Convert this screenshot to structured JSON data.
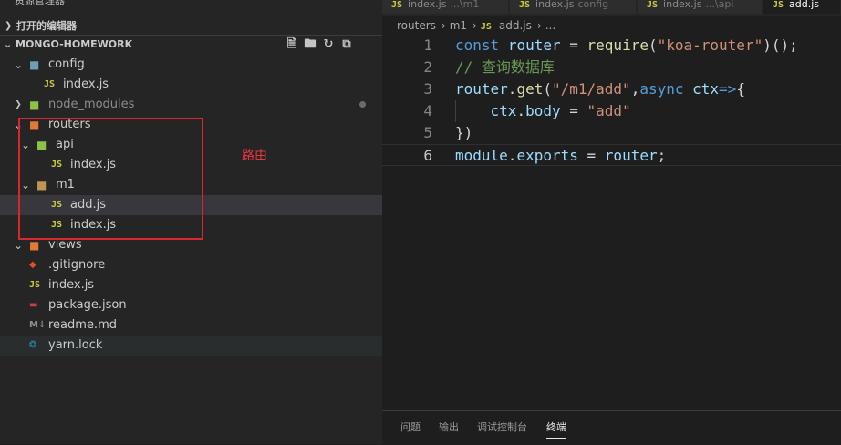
{
  "sidebar": {
    "explorer_title": "资源管理器",
    "open_editors_label": "打开的编辑器",
    "project_label": "MONGO-HOMEWORK",
    "tree": [
      {
        "label": "config",
        "type": "folder-open",
        "depth": 1
      },
      {
        "label": "index.js",
        "type": "js",
        "depth": 2
      },
      {
        "label": "node_modules",
        "type": "folder",
        "depth": 1
      },
      {
        "label": "routers",
        "type": "folder-open",
        "depth": 1
      },
      {
        "label": "api",
        "type": "folder-open",
        "depth": 2
      },
      {
        "label": "index.js",
        "type": "js",
        "depth": 3
      },
      {
        "label": "m1",
        "type": "folder-open",
        "depth": 2
      },
      {
        "label": "add.js",
        "type": "js",
        "depth": 3
      },
      {
        "label": "index.js",
        "type": "js",
        "depth": 3
      },
      {
        "label": "views",
        "type": "folder-open",
        "depth": 1
      },
      {
        "label": ".gitignore",
        "type": "git",
        "depth": 1
      },
      {
        "label": "index.js",
        "type": "js",
        "depth": 1
      },
      {
        "label": "package.json",
        "type": "json",
        "depth": 1
      },
      {
        "label": "readme.md",
        "type": "md",
        "depth": 1
      },
      {
        "label": "yarn.lock",
        "type": "yarn",
        "depth": 1
      }
    ],
    "js_icon_text": "JS"
  },
  "tabs": [
    {
      "name": "index.js",
      "hint": "...\\m1"
    },
    {
      "name": "index.js",
      "hint": "config"
    },
    {
      "name": "index.js",
      "hint": "...\\api"
    },
    {
      "name": "add.js",
      "hint": ""
    }
  ],
  "breadcrumb": {
    "parts": [
      "routers",
      "m1",
      "add.js",
      "..."
    ],
    "sep": "›"
  },
  "editor": {
    "line_numbers": [
      "1",
      "2",
      "3",
      "4",
      "5",
      "6"
    ],
    "lines": [
      "const router = require(\"koa-router\")();",
      "// 查询数据库",
      "router.get(\"/m1/add\",async ctx=>{",
      "    ctx.body = \"add\"",
      "})",
      "module.exports = router;"
    ]
  },
  "panel": {
    "tabs": [
      "问题",
      "输出",
      "调试控制台",
      "终端"
    ],
    "active": "终端"
  },
  "annotation": {
    "label": "路由"
  }
}
